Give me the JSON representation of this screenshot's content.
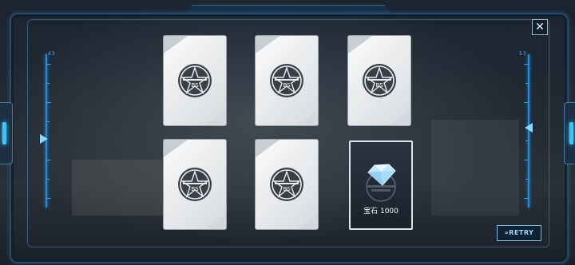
{
  "colors": {
    "accent": "#37c6ff",
    "frame": "#2b4a66",
    "card_face": "#e9ebed",
    "reward_border": "#d9e3ec"
  },
  "header": {
    "close_label": "✕"
  },
  "gauges": {
    "left": {
      "label": "43"
    },
    "right": {
      "label": "53"
    }
  },
  "cards": [
    {
      "emblem_text": "BS",
      "state": "face-down"
    },
    {
      "emblem_text": "BS",
      "state": "face-down"
    },
    {
      "emblem_text": "BS",
      "state": "face-down"
    },
    {
      "emblem_text": "BS",
      "state": "face-down"
    },
    {
      "emblem_text": "BS",
      "state": "face-down"
    }
  ],
  "reward": {
    "icon": "gem-icon",
    "label": "宝石 1000",
    "state": "revealed"
  },
  "footer": {
    "retry_label": "»RETRY"
  }
}
